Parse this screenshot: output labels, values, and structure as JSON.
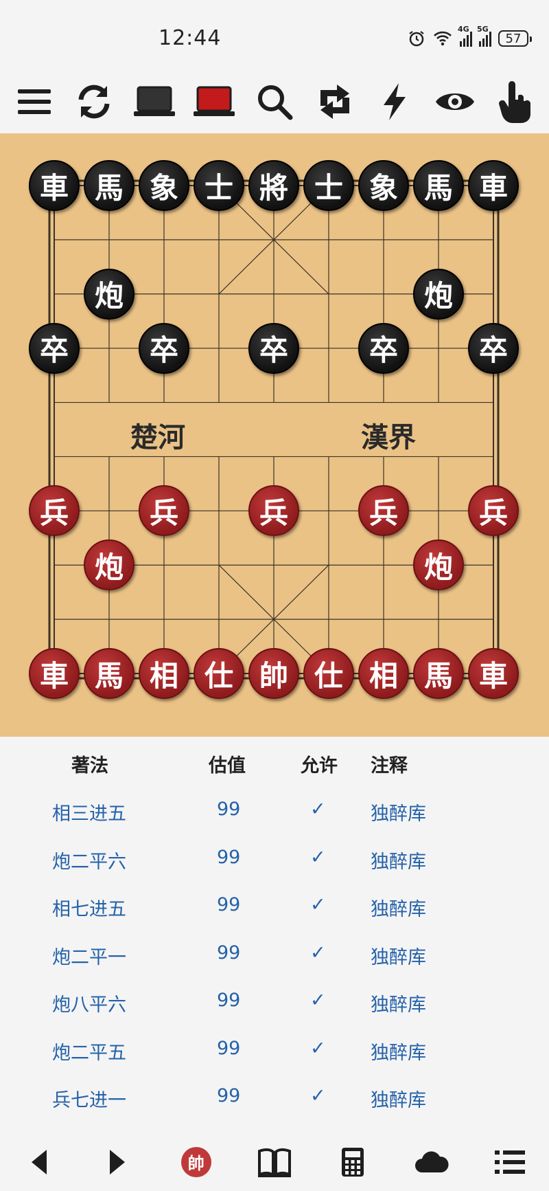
{
  "status_bar": {
    "time": "12:44",
    "sig1_tag": "4G",
    "sig2_tag": "5G",
    "battery": "57"
  },
  "toolbar": {
    "icons": [
      "menu-icon",
      "refresh-icon",
      "black-laptop-icon",
      "red-laptop-icon",
      "search-icon",
      "flip-icon",
      "flash-icon",
      "eye-icon",
      "touch-icon"
    ]
  },
  "board": {
    "river_left": "楚河",
    "river_right": "漢界",
    "pieces": [
      {
        "c": 0,
        "r": 0,
        "t": "車",
        "side": "black"
      },
      {
        "c": 1,
        "r": 0,
        "t": "馬",
        "side": "black"
      },
      {
        "c": 2,
        "r": 0,
        "t": "象",
        "side": "black"
      },
      {
        "c": 3,
        "r": 0,
        "t": "士",
        "side": "black"
      },
      {
        "c": 4,
        "r": 0,
        "t": "將",
        "side": "black"
      },
      {
        "c": 5,
        "r": 0,
        "t": "士",
        "side": "black"
      },
      {
        "c": 6,
        "r": 0,
        "t": "象",
        "side": "black"
      },
      {
        "c": 7,
        "r": 0,
        "t": "馬",
        "side": "black"
      },
      {
        "c": 8,
        "r": 0,
        "t": "車",
        "side": "black"
      },
      {
        "c": 1,
        "r": 2,
        "t": "炮",
        "side": "black"
      },
      {
        "c": 7,
        "r": 2,
        "t": "炮",
        "side": "black"
      },
      {
        "c": 0,
        "r": 3,
        "t": "卒",
        "side": "black"
      },
      {
        "c": 2,
        "r": 3,
        "t": "卒",
        "side": "black"
      },
      {
        "c": 4,
        "r": 3,
        "t": "卒",
        "side": "black"
      },
      {
        "c": 6,
        "r": 3,
        "t": "卒",
        "side": "black"
      },
      {
        "c": 8,
        "r": 3,
        "t": "卒",
        "side": "black"
      },
      {
        "c": 0,
        "r": 6,
        "t": "兵",
        "side": "red"
      },
      {
        "c": 2,
        "r": 6,
        "t": "兵",
        "side": "red"
      },
      {
        "c": 4,
        "r": 6,
        "t": "兵",
        "side": "red"
      },
      {
        "c": 6,
        "r": 6,
        "t": "兵",
        "side": "red"
      },
      {
        "c": 8,
        "r": 6,
        "t": "兵",
        "side": "red"
      },
      {
        "c": 1,
        "r": 7,
        "t": "炮",
        "side": "red"
      },
      {
        "c": 7,
        "r": 7,
        "t": "炮",
        "side": "red"
      },
      {
        "c": 0,
        "r": 9,
        "t": "車",
        "side": "red"
      },
      {
        "c": 1,
        "r": 9,
        "t": "馬",
        "side": "red"
      },
      {
        "c": 2,
        "r": 9,
        "t": "相",
        "side": "red"
      },
      {
        "c": 3,
        "r": 9,
        "t": "仕",
        "side": "red"
      },
      {
        "c": 4,
        "r": 9,
        "t": "帥",
        "side": "red"
      },
      {
        "c": 5,
        "r": 9,
        "t": "仕",
        "side": "red"
      },
      {
        "c": 6,
        "r": 9,
        "t": "相",
        "side": "red"
      },
      {
        "c": 7,
        "r": 9,
        "t": "馬",
        "side": "red"
      },
      {
        "c": 8,
        "r": 9,
        "t": "車",
        "side": "red"
      }
    ]
  },
  "moves_table": {
    "headers": {
      "move": "著法",
      "score": "估值",
      "allowed": "允许",
      "note": "注释"
    },
    "rows": [
      {
        "move": "相三进五",
        "score": "99",
        "allowed": "✓",
        "note": "独醉库"
      },
      {
        "move": "炮二平六",
        "score": "99",
        "allowed": "✓",
        "note": "独醉库"
      },
      {
        "move": "相七进五",
        "score": "99",
        "allowed": "✓",
        "note": "独醉库"
      },
      {
        "move": "炮二平一",
        "score": "99",
        "allowed": "✓",
        "note": "独醉库"
      },
      {
        "move": "炮八平六",
        "score": "99",
        "allowed": "✓",
        "note": "独醉库"
      },
      {
        "move": "炮二平五",
        "score": "99",
        "allowed": "✓",
        "note": "独醉库"
      },
      {
        "move": "兵七进一",
        "score": "99",
        "allowed": "✓",
        "note": "独醉库"
      }
    ]
  },
  "bottom_bar": {
    "shuai_label": "帥"
  },
  "colors": {
    "board": "#eac286",
    "red_piece": "#a82426",
    "black_piece": "#1a1a1a",
    "link_blue": "#2562a8"
  }
}
